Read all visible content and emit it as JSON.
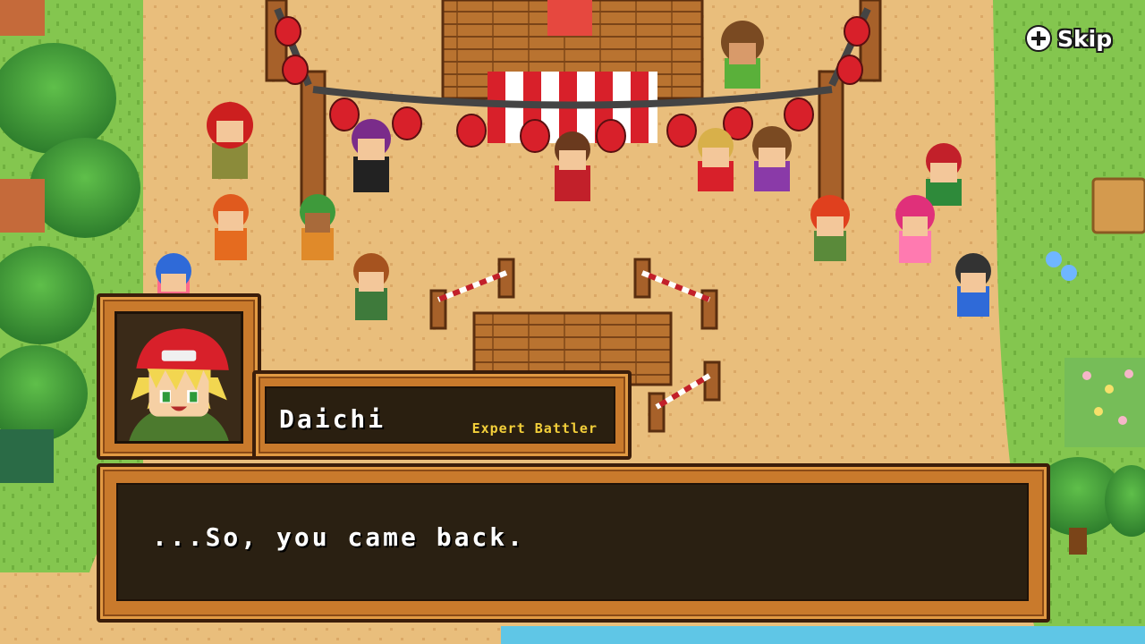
{
  "hud": {
    "skip_label": "Skip",
    "skip_icon": "plus-circle-icon"
  },
  "dialog": {
    "speaker": "Daichi",
    "speaker_title": "Expert Battler",
    "line": "...So, you came back.",
    "portrait": "daichi-portrait"
  },
  "colors": {
    "wood": "#c97a2c",
    "wood_dark": "#3b1d0a",
    "dialog_bg": "#1c1810",
    "title_yellow": "#f3cf3a",
    "sand": "#e9be7c",
    "grass": "#7cc24a",
    "lantern_red": "#d8202a"
  }
}
